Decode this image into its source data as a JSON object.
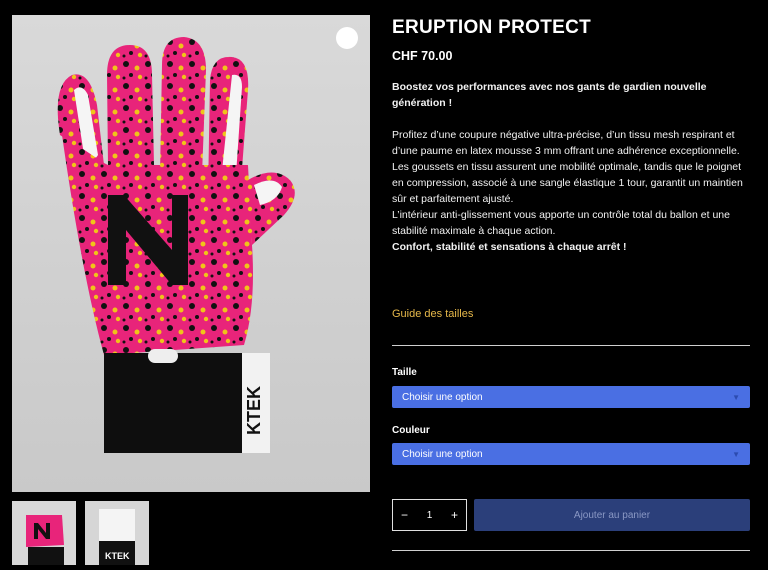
{
  "product": {
    "title": "ERUPTION PROTECT",
    "price": "CHF 70.00",
    "description": {
      "lead": "Boostez vos performances avec nos gants de gardien nouvelle génération !",
      "body1": "Profitez d’une coupure négative ultra-précise, d’un tissu mesh respirant et d’une paume en latex mousse 3 mm offrant une adhérence exceptionnelle.",
      "body2": "Les goussets en tissu assurent une mobilité optimale, tandis que le poignet en compression, associé à une sangle élastique 1 tour, garantit un maintien sûr et parfaitement ajusté.",
      "body3": "L’intérieur anti-glissement vous apporte un contrôle total du ballon et une stabilité maximale à chaque action.",
      "closing": "Confort, stabilité et sensations à chaque arrêt !"
    },
    "size_guide": "Guide des tailles",
    "taille": {
      "label": "Taille",
      "value": "Choisir une option"
    },
    "couleur": {
      "label": "Couleur",
      "value": "Choisir une option"
    },
    "quantity": {
      "minus": "−",
      "value": "1",
      "plus": "+"
    },
    "add_to_cart": "Ajouter au panier",
    "strap_text": "KTEK",
    "thumb_strap_text": "KTEK"
  },
  "colors": {
    "accent_select": "#4a6fe3",
    "button_disabled": "#2b3f7a",
    "link": "#e6b84a"
  }
}
